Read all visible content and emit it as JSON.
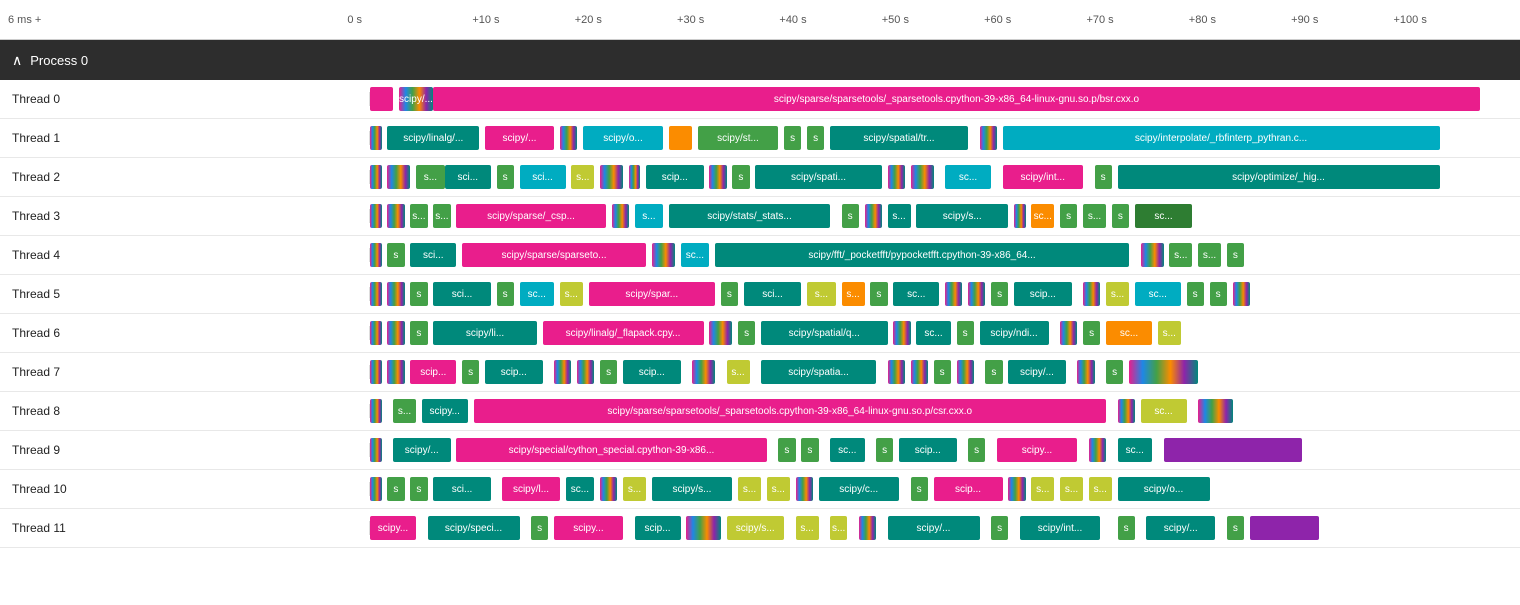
{
  "header": {
    "left_label": "6 ms +",
    "right_label": "0 s",
    "time_markers": [
      {
        "label": "+10 s",
        "pct": 8.9
      },
      {
        "label": "+20 s",
        "pct": 17.8
      },
      {
        "label": "+30 s",
        "pct": 26.7
      },
      {
        "label": "+40 s",
        "pct": 35.6
      },
      {
        "label": "+50 s",
        "pct": 44.5
      },
      {
        "label": "+60 s",
        "pct": 53.4
      },
      {
        "label": "+70 s",
        "pct": 62.3
      },
      {
        "label": "+80 s",
        "pct": 71.2
      },
      {
        "label": "+90 s",
        "pct": 80.1
      },
      {
        "label": "+100 s",
        "pct": 89.0
      }
    ]
  },
  "process": {
    "label": "Process 0"
  },
  "threads": [
    {
      "id": 0,
      "label": "Thread 0"
    },
    {
      "id": 1,
      "label": "Thread 1"
    },
    {
      "id": 2,
      "label": "Thread 2"
    },
    {
      "id": 3,
      "label": "Thread 3"
    },
    {
      "id": 4,
      "label": "Thread 4"
    },
    {
      "id": 5,
      "label": "Thread 5"
    },
    {
      "id": 6,
      "label": "Thread 6"
    },
    {
      "id": 7,
      "label": "Thread 7"
    },
    {
      "id": 8,
      "label": "Thread 8"
    },
    {
      "id": 9,
      "label": "Thread 9"
    },
    {
      "id": 10,
      "label": "Thread 10"
    },
    {
      "id": 11,
      "label": "Thread 11"
    }
  ]
}
